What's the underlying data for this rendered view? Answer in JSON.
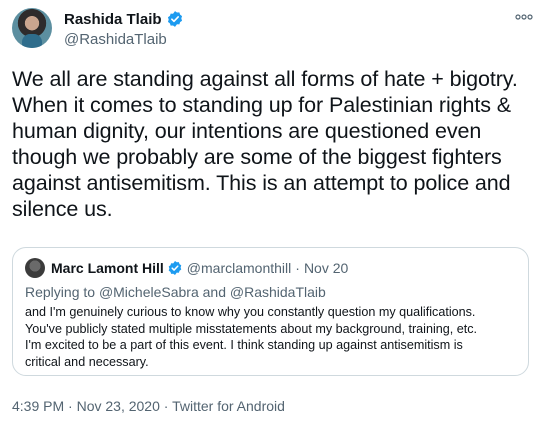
{
  "author": {
    "name": "Rashida Tlaib",
    "handle": "@RashidaTlaib"
  },
  "tweet": {
    "text": "We all are standing against all forms of hate + bigotry.\nWhen it comes to standing up for Palestinian rights &\nhuman dignity, our intentions are questioned even\nthough we probably are some of the biggest fighters\nagainst antisemitism. This is an attempt to police and\nsilence us."
  },
  "quoted": {
    "name": "Marc Lamont Hill",
    "handle": "@marclamonthill",
    "separator": "·",
    "date": "Nov 20",
    "reply_prefix": "Replying to ",
    "reply_to": "@MicheleSabra and @RashidaTlaib",
    "text": "and I'm genuinely curious to know why you constantly question my qualifications.\nYou've publicly stated multiple misstatements about my background, training, etc.\nI'm excited to be a part of this event. I think standing up against antisemitism is\ncritical and necessary."
  },
  "footer": {
    "time": "4:39 PM",
    "separator1": "·",
    "date": "Nov 23, 2020",
    "separator2": "·",
    "source": "Twitter for Android"
  },
  "icons": {
    "verified": "verified-badge-icon",
    "more": "more-options-icon"
  },
  "colors": {
    "accent": "#1d9bf0",
    "secondary_text": "#536471",
    "primary_text": "#0f1419",
    "border": "#cfd9de"
  }
}
